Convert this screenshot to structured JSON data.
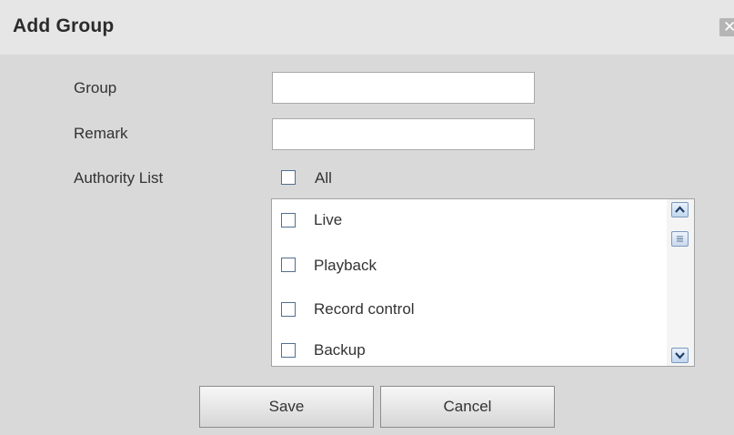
{
  "dialog": {
    "title": "Add Group",
    "close_glyph": "✕"
  },
  "form": {
    "group_label": "Group",
    "group_value": "",
    "remark_label": "Remark",
    "remark_value": "",
    "authority_label": "Authority List",
    "all_label": "All"
  },
  "authority_list": {
    "items": [
      {
        "label": "Live",
        "checked": false
      },
      {
        "label": "Playback",
        "checked": false
      },
      {
        "label": "Record control",
        "checked": false
      },
      {
        "label": "Backup",
        "checked": false
      }
    ]
  },
  "buttons": {
    "save_label": "Save",
    "cancel_label": "Cancel"
  },
  "icons": {
    "close": "close-icon",
    "scroll_up": "chevron-up-icon",
    "scroll_down": "chevron-down-icon",
    "scroll_thumb": "grip-icon"
  },
  "colors": {
    "dialog_bg": "#d9d9d9",
    "titlebar_bg": "#e6e6e6",
    "checkbox_border": "#4f6f91",
    "scroll_accent": "#7d98ba"
  }
}
